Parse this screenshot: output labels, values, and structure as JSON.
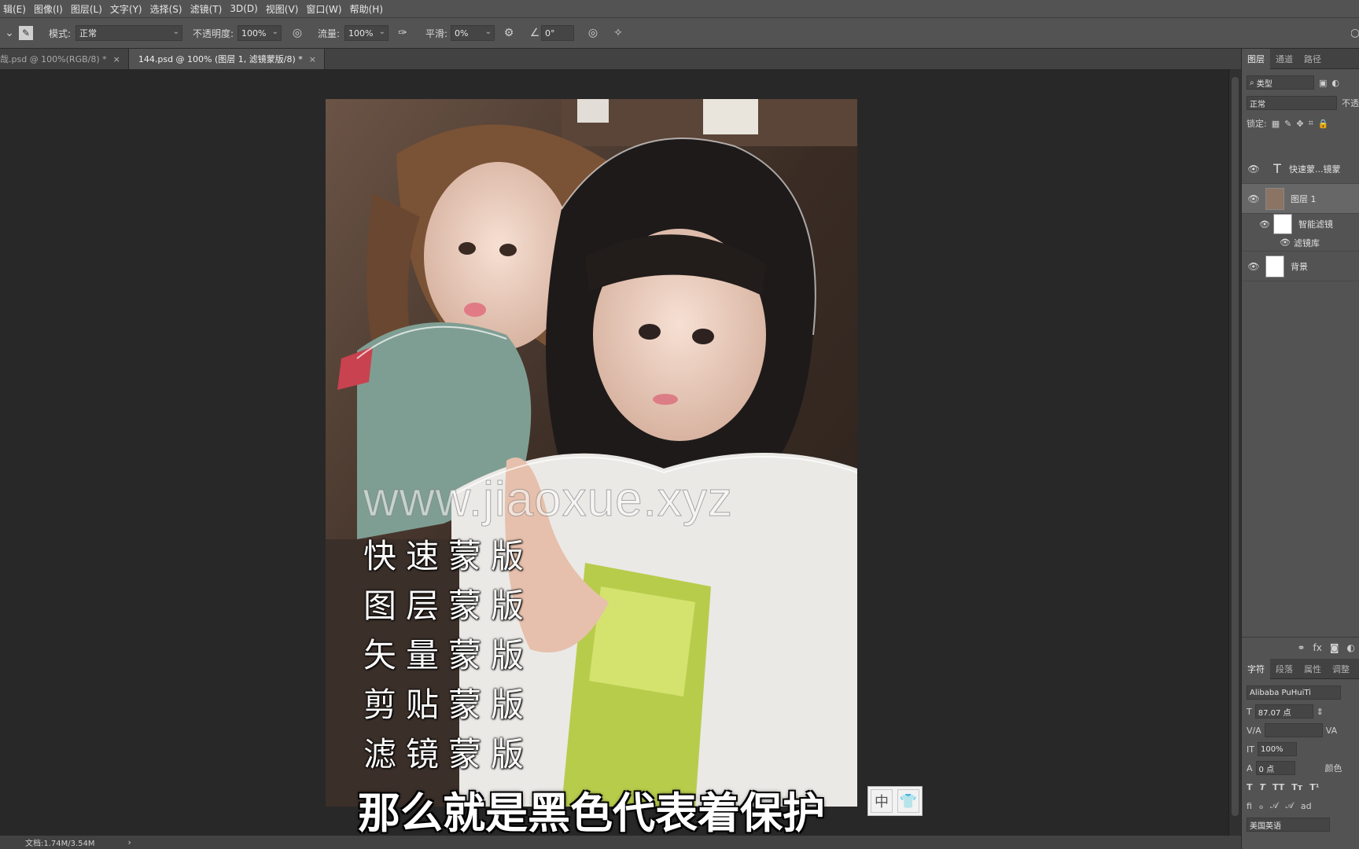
{
  "menu": [
    "辑(E)",
    "图像(I)",
    "图层(L)",
    "文字(Y)",
    "选择(S)",
    "滤镜(T)",
    "3D(D)",
    "视图(V)",
    "窗口(W)",
    "帮助(H)"
  ],
  "options": {
    "mode_label": "模式:",
    "mode_value": "正常",
    "opacity_label": "不透明度:",
    "opacity_value": "100%",
    "flow_label": "流量:",
    "flow_value": "100%",
    "smooth_label": "平滑:",
    "smooth_value": "0%",
    "angle_value": "0°"
  },
  "tabs": [
    {
      "label": "哉.psd @ 100%(RGB/8) *",
      "active": false
    },
    {
      "label": "144.psd @ 100% (图层 1, 滤镜蒙版/8) *",
      "active": true
    }
  ],
  "canvas": {
    "watermark": "www.jiaoxue.xyz",
    "mask_types": [
      "快速蒙版",
      "图层蒙版",
      "矢量蒙版",
      "剪贴蒙版",
      "滤镜蒙版"
    ],
    "subtitle": "那么就是黑色代表着保护",
    "ime_mode": "中"
  },
  "status": {
    "doc_info": "文档:1.74M/3.54M"
  },
  "layers_panel": {
    "tabs": [
      "图层",
      "通道",
      "路径"
    ],
    "filter_kind": "类型",
    "blend_mode": "正常",
    "opacity_short": "不透",
    "lock_label": "锁定:",
    "layers": [
      {
        "name": "快速蒙...镜蒙",
        "kind": "text"
      },
      {
        "name": "图层 1",
        "kind": "image",
        "selected": true
      },
      {
        "name": "智能滤镜",
        "kind": "smart-filter"
      },
      {
        "name": "滤镜库",
        "kind": "filter"
      },
      {
        "name": "背景",
        "kind": "background"
      }
    ]
  },
  "character_panel": {
    "tabs": [
      "字符",
      "段落",
      "属性",
      "调整"
    ],
    "font_family": "Alibaba PuHuiTi",
    "font_size": "87.07 点",
    "vertical_scale": "100%",
    "baseline_shift": "0 点",
    "color_label": "颜色",
    "language": "美国英语"
  }
}
